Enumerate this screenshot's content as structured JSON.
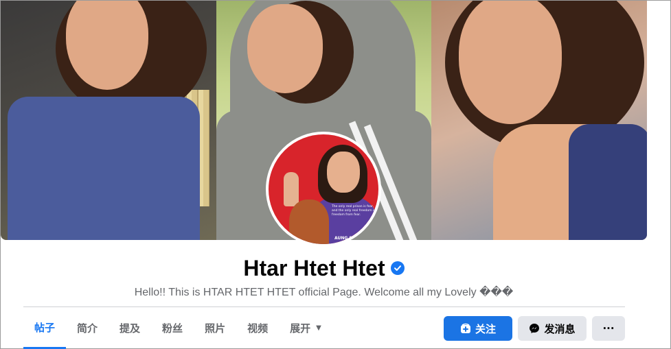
{
  "profile": {
    "name": "Htar Htet Htet",
    "bio": "Hello!! This is HTAR HTET HTET official Page. Welcome all my Lovely ���",
    "verified": true,
    "avatar_caption_name": "AUNG SAN SU KYI",
    "avatar_caption_quote": "The only real prison is fear, and the only real freedom is freedom from fear."
  },
  "tabs": [
    {
      "label": "帖子",
      "active": true
    },
    {
      "label": "简介"
    },
    {
      "label": "提及"
    },
    {
      "label": "粉丝"
    },
    {
      "label": "照片"
    },
    {
      "label": "视频"
    },
    {
      "label": "展开"
    }
  ],
  "actions": {
    "follow_label": "关注",
    "message_label": "发消息",
    "more_label": "···"
  },
  "colors": {
    "accent": "#1877f2",
    "follow_bg": "#1b74e4",
    "secondary_bg": "#e4e6eb",
    "text_secondary": "#65676b"
  },
  "icons": {
    "verified": "verified-badge-icon",
    "follow": "follow-plus-icon",
    "message": "messenger-icon",
    "more": "more-dots-icon",
    "expand": "caret-down-icon"
  }
}
